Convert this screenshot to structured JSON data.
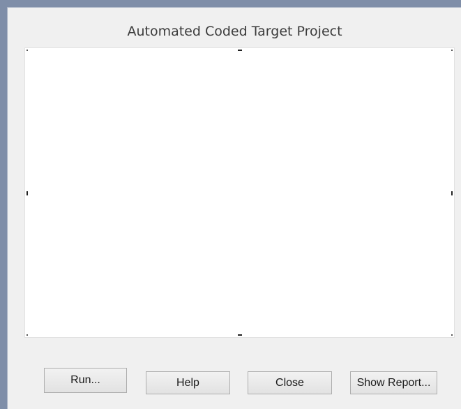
{
  "dialog": {
    "title": "Automated Coded Target Project"
  },
  "buttons": {
    "run_label": "Run...",
    "help_label": "Help",
    "close_label": "Close",
    "report_label": "Show Report..."
  }
}
